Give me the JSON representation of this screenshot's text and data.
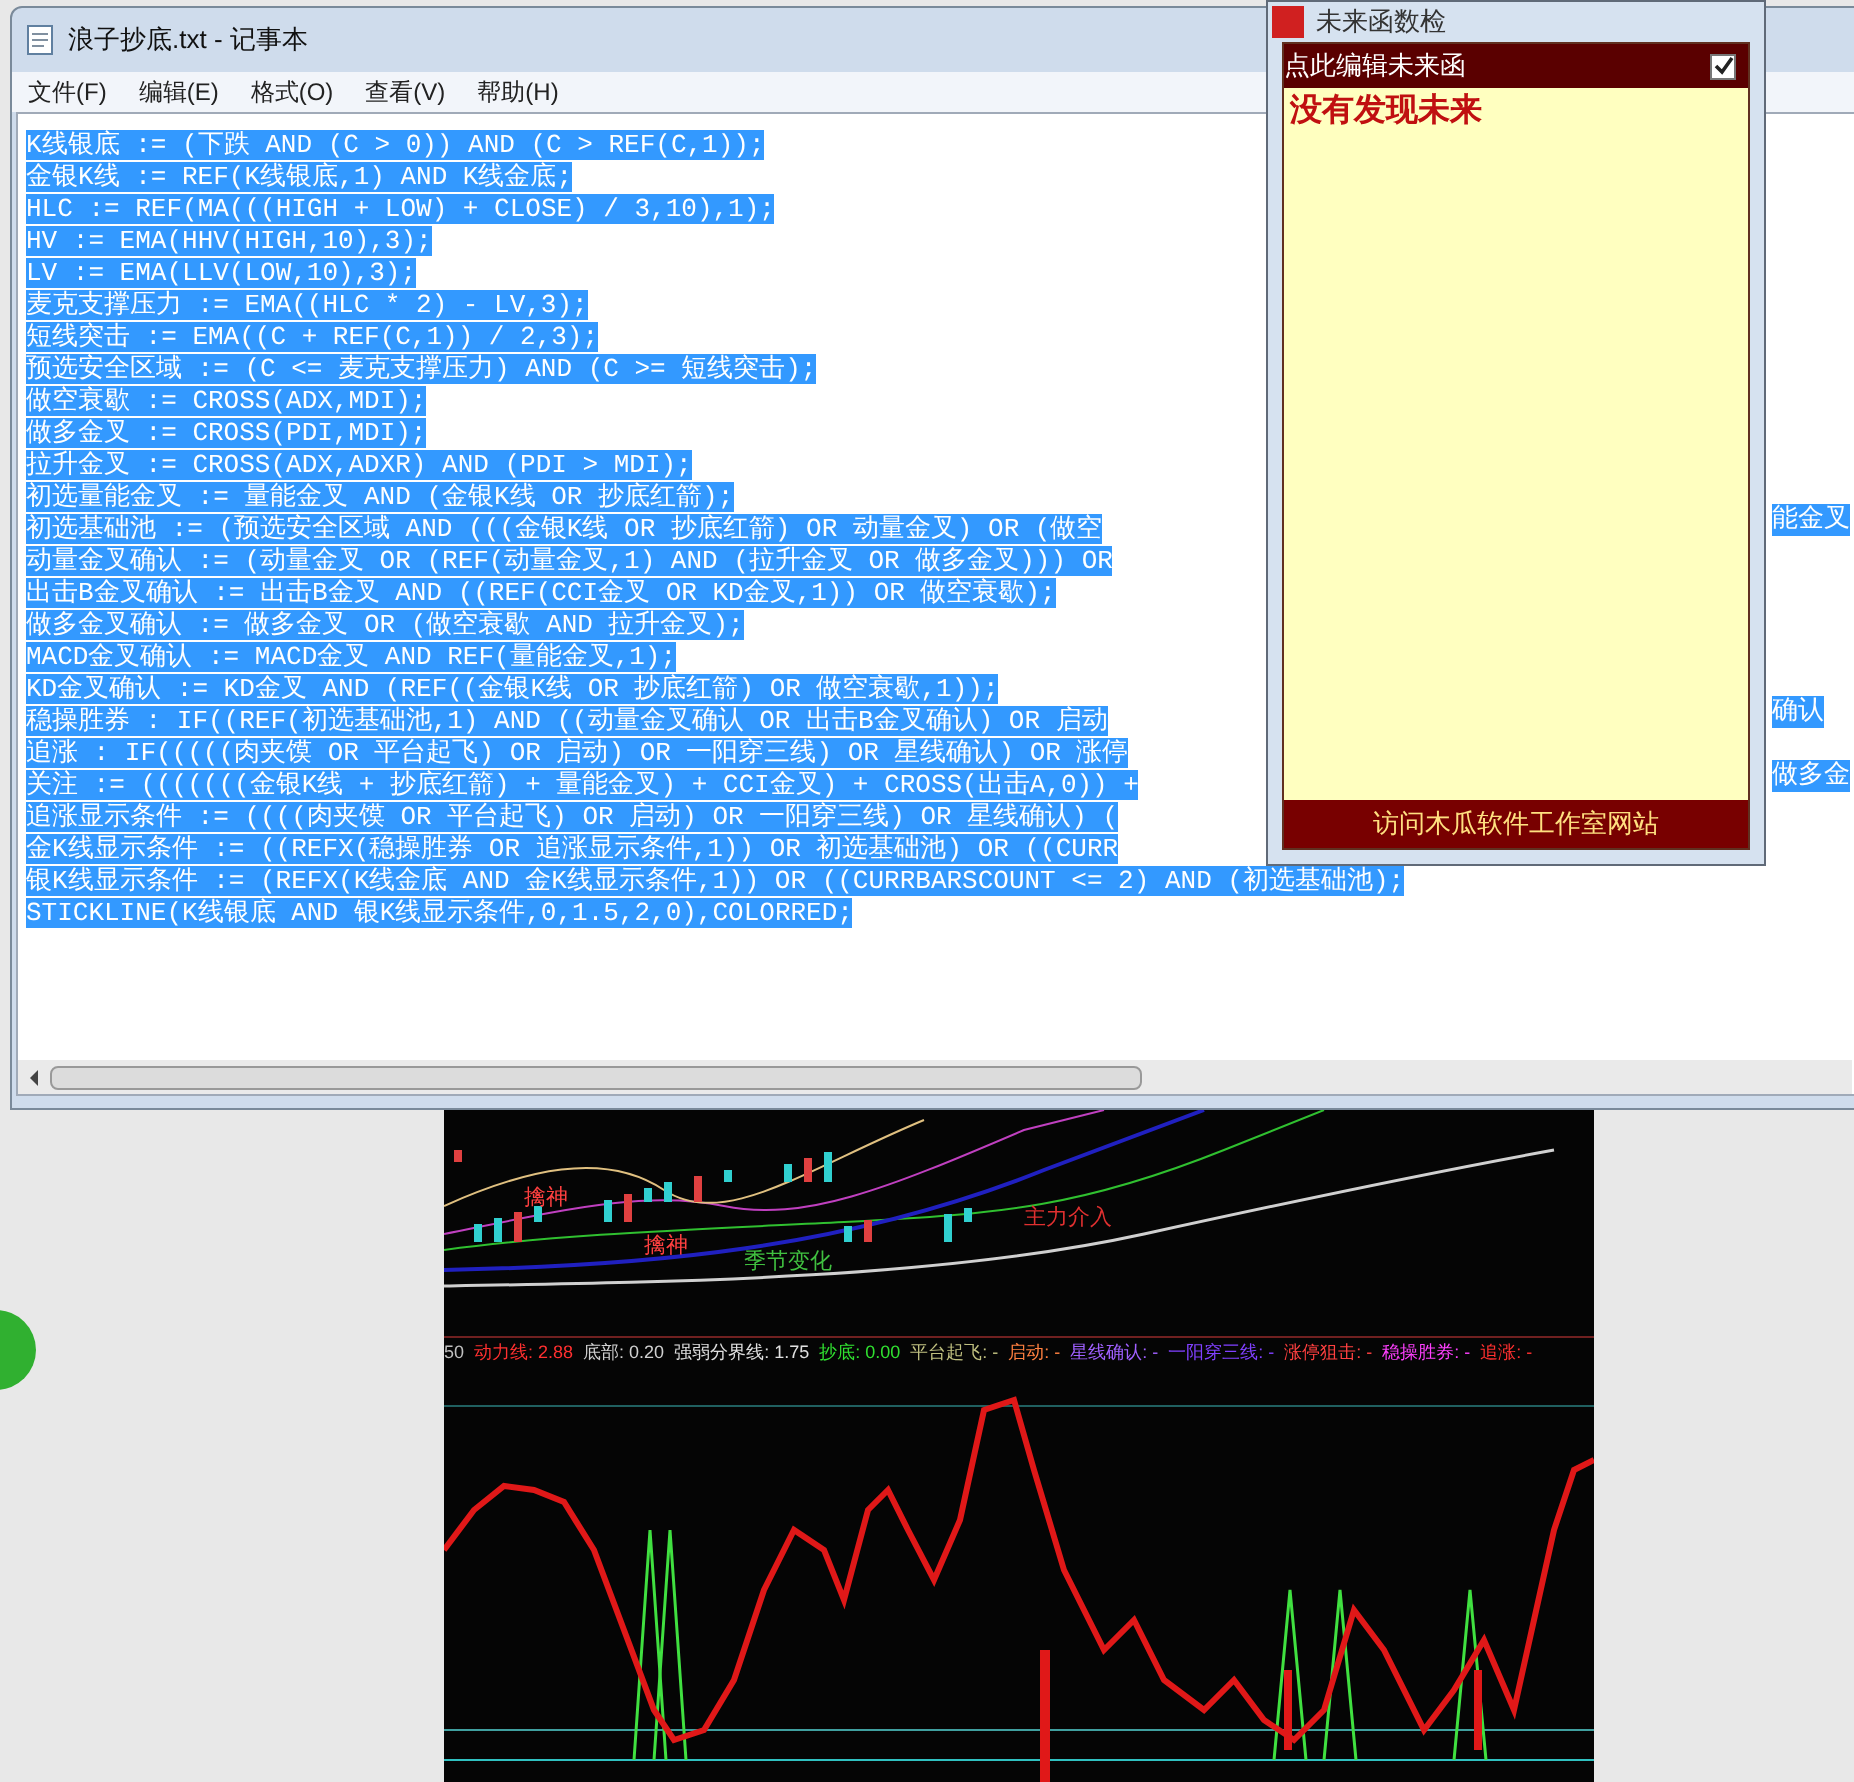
{
  "notepad": {
    "title": "浪子抄底.txt - 记事本",
    "menu": [
      "文件(F)",
      "编辑(E)",
      "格式(O)",
      "查看(V)",
      "帮助(H)"
    ],
    "lines": [
      {
        "text": "K线银底 := (下跌 AND (C > 0)) AND (C > REF(C,1));"
      },
      {
        "text": "金银K线 := REF(K线银底,1) AND K线金底;"
      },
      {
        "text": "HLC := REF(MA(((HIGH + LOW) + CLOSE) / 3,10),1);"
      },
      {
        "text": "HV := EMA(HHV(HIGH,10),3);"
      },
      {
        "text": "LV := EMA(LLV(LOW,10),3);"
      },
      {
        "text": "麦克支撑压力 := EMA((HLC * 2) - LV,3);"
      },
      {
        "text": "短线突击 := EMA((C + REF(C,1)) / 2,3);"
      },
      {
        "text": "预选安全区域 := (C <= 麦克支撑压力) AND (C >= 短线突击);"
      },
      {
        "text": "做空衰歇 := CROSS(ADX,MDI);"
      },
      {
        "text": "做多金叉 := CROSS(PDI,MDI);"
      },
      {
        "text": "拉升金叉 := CROSS(ADX,ADXR) AND (PDI > MDI);"
      },
      {
        "text": "初选量能金叉 := 量能金叉 AND (金银K线 OR 抄底红箭);"
      },
      {
        "text": "初选基础池 := (预选安全区域 AND (((金银K线 OR 抄底红箭) OR 动量金叉) OR (做空",
        "right": "能金叉"
      },
      {
        "text": "动量金叉确认 := (动量金叉 OR (REF(动量金叉,1) AND (拉升金叉 OR 做多金叉))) OR"
      },
      {
        "text": "出击B金叉确认 := 出击B金叉 AND ((REF(CCI金叉 OR KD金叉,1)) OR 做空衰歇);"
      },
      {
        "text": "做多金叉确认 := 做多金叉 OR (做空衰歇 AND 拉升金叉);"
      },
      {
        "text": "MACD金叉确认 := MACD金叉 AND REF(量能金叉,1);"
      },
      {
        "text": "KD金叉确认 := KD金叉 AND (REF((金银K线 OR 抄底红箭) OR 做空衰歇,1));"
      },
      {
        "text": "稳操胜券 : IF((REF(初选基础池,1) AND ((动量金叉确认 OR 出击B金叉确认) OR 启动",
        "right": "确认"
      },
      {
        "text": "追涨 : IF(((((肉夹馍 OR 平台起飞) OR 启动) OR 一阳穿三线) OR 星线确认) OR 涨停"
      },
      {
        "text": "关注 := (((((((金银K线 + 抄底红箭) + 量能金叉) + CCI金叉) + CROSS(出击A,0)) +",
        "right": "做多金"
      },
      {
        "text": "追涨显示条件 := ((((肉夹馍 OR 平台起飞) OR 启动) OR 一阳穿三线) OR 星线确认) ("
      },
      {
        "text": "金K线显示条件 := ((REFX(稳操胜券 OR 追涨显示条件,1)) OR 初选基础池) OR ((CURR"
      },
      {
        "text": "银K线显示条件 := (REFX(K线金底 AND 金K线显示条件,1)) OR ((CURRBARSCOUNT <= 2) AND (初选基础池);"
      },
      {
        "text": "STICKLINE(K线银底 AND 银K线显示条件,0,1.5,2,0),COLORRED;"
      }
    ]
  },
  "popup": {
    "title": "未来函数检",
    "edit_link": "点此编辑未来函",
    "always_on_top": {
      "checked": true
    },
    "message": "没有发现未来",
    "footer_link": "访问木瓜软件工作室网站"
  },
  "chart": {
    "labels": [
      {
        "text": "擒神",
        "color": "#ff4040"
      },
      {
        "text": "擒神",
        "color": "#ff4040"
      },
      {
        "text": "季节变化",
        "color": "#40c040"
      },
      {
        "text": "主力介入",
        "color": "#e03030"
      }
    ],
    "readout": [
      {
        "text": "50",
        "color": "#c0c0c0"
      },
      {
        "text": "动力线: 2.88",
        "color": "#ff3030"
      },
      {
        "text": "底部: 0.20",
        "color": "#d0d0d0"
      },
      {
        "text": "强弱分界线: 1.75",
        "color": "#e0e0e0"
      },
      {
        "text": "抄底: 0.00",
        "color": "#30e030"
      },
      {
        "text": "平台起飞: -",
        "color": "#c0c080"
      },
      {
        "text": "启动: -",
        "color": "#ff8040"
      },
      {
        "text": "星线确认: -",
        "color": "#a060ff"
      },
      {
        "text": "一阳穿三线: -",
        "color": "#8040ff"
      },
      {
        "text": "涨停狙击: -",
        "color": "#ff4040"
      },
      {
        "text": "稳操胜券: -",
        "color": "#ff40ff"
      },
      {
        "text": "追涨: -",
        "color": "#ff3030"
      }
    ]
  }
}
